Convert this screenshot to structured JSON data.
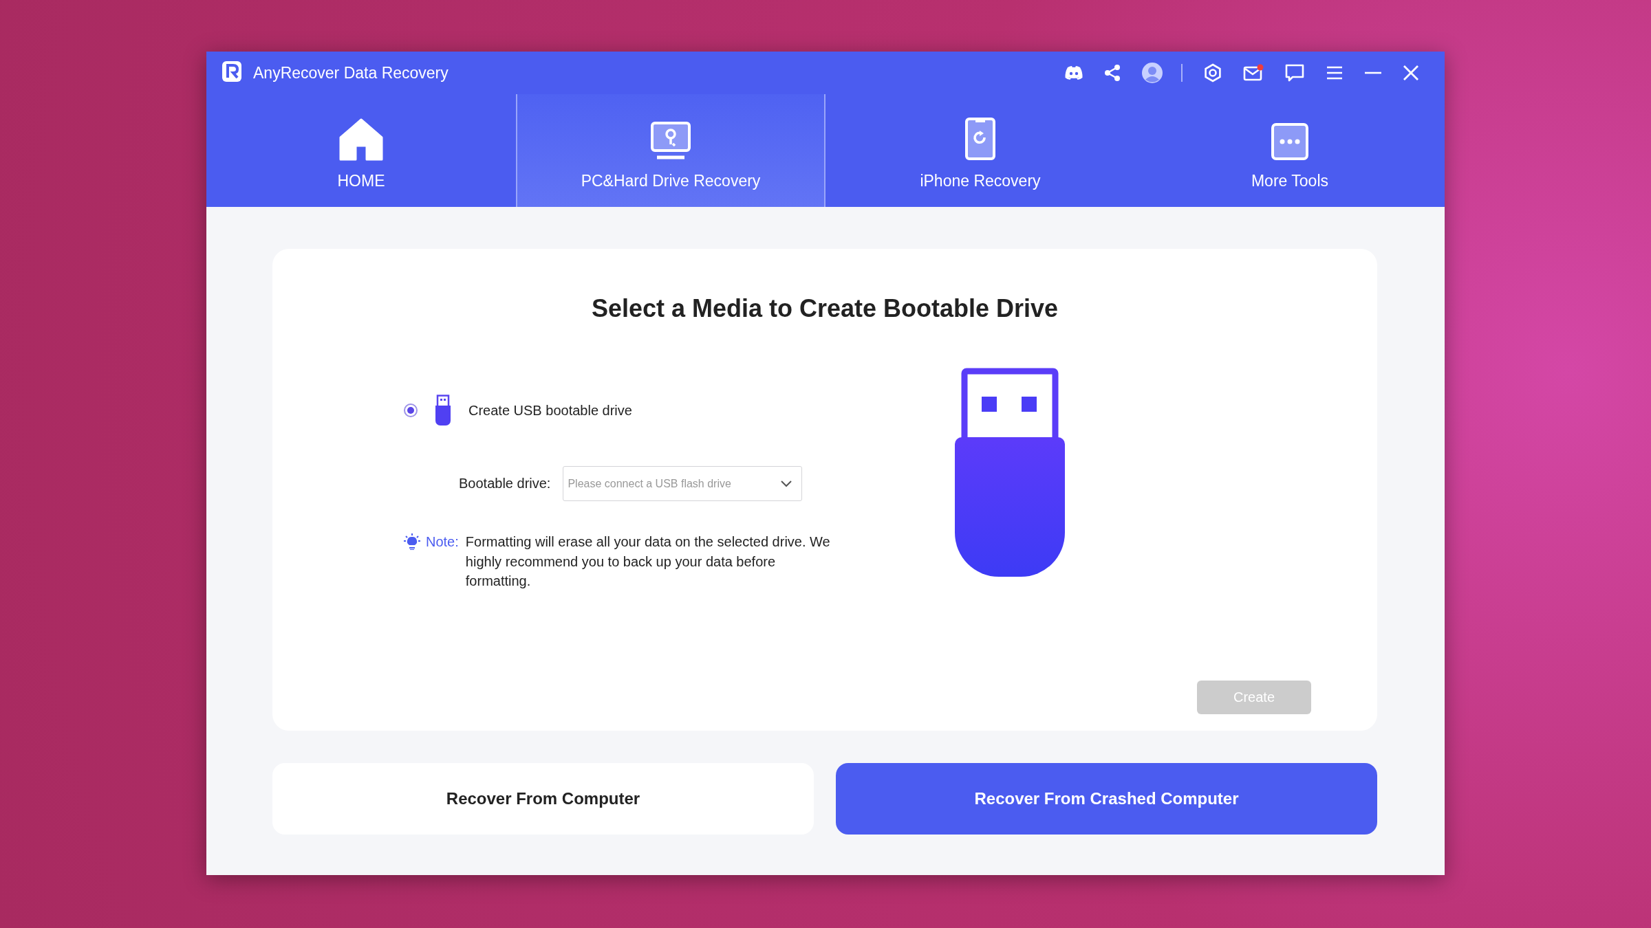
{
  "window": {
    "title": "AnyRecover Data Recovery",
    "mail_unread": true
  },
  "tabs": [
    {
      "label": "HOME",
      "kind": "home",
      "selected": false
    },
    {
      "label": "PC&Hard Drive Recovery",
      "kind": "pc",
      "selected": true
    },
    {
      "label": "iPhone Recovery",
      "kind": "phone",
      "selected": false
    },
    {
      "label": "More Tools",
      "kind": "more",
      "selected": false
    }
  ],
  "panel": {
    "heading": "Select a Media to Create Bootable Drive",
    "options": [
      {
        "label": "Create USB bootable drive",
        "selected": true
      }
    ],
    "bootable_drive": {
      "label": "Bootable drive:",
      "placeholder": "Please connect a USB flash drive"
    },
    "note": {
      "label": "Note:",
      "text": "Formatting will erase all your data on the selected drive. We highly recommend you to back up your data before formatting."
    },
    "create_button": {
      "label": "Create",
      "disabled": true
    }
  },
  "bottom_buttons": [
    {
      "label": "Recover From Computer",
      "selected": false
    },
    {
      "label": "Recover From Crashed Computer",
      "selected": true
    }
  ]
}
